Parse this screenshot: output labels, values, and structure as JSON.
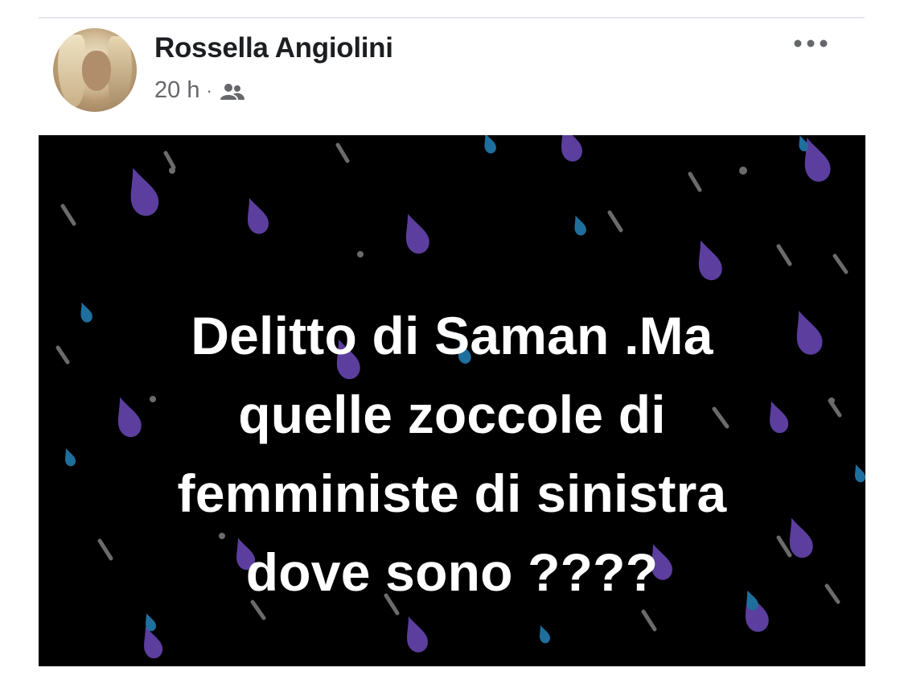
{
  "post": {
    "author": "Rossella Angiolini",
    "time": "20 h",
    "separator": "·",
    "audience_icon": "friends-icon",
    "more_icon": "more-horizontal-icon",
    "image_text_lines": [
      "Delitto di Saman .Ma",
      "quelle zoccole di",
      "femministe di sinistra",
      "dove sono ????"
    ]
  },
  "colors": {
    "name": "#1c1e21",
    "meta": "#65676b",
    "image_background": "#000000",
    "drop_purple": "#5b3e9e",
    "drop_blue": "#1f6f9e",
    "streak_gray": "#6b6b6b"
  }
}
